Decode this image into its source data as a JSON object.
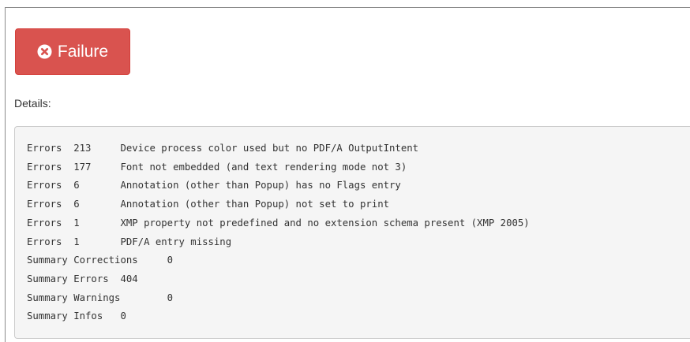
{
  "status": {
    "label": "Failure",
    "icon": "times-circle-icon",
    "color": "#d9534f"
  },
  "details": {
    "label": "Details:",
    "lines": [
      "Errors  213     Device process color used but no PDF/A OutputIntent",
      "Errors  177     Font not embedded (and text rendering mode not 3)",
      "Errors  6       Annotation (other than Popup) has no Flags entry",
      "Errors  6       Annotation (other than Popup) not set to print",
      "Errors  1       XMP property not predefined and no extension schema present (XMP 2005)",
      "Errors  1       PDF/A entry missing",
      "Summary Corrections     0",
      "Summary Errors  404",
      "Summary Warnings        0",
      "Summary Infos   0"
    ]
  }
}
